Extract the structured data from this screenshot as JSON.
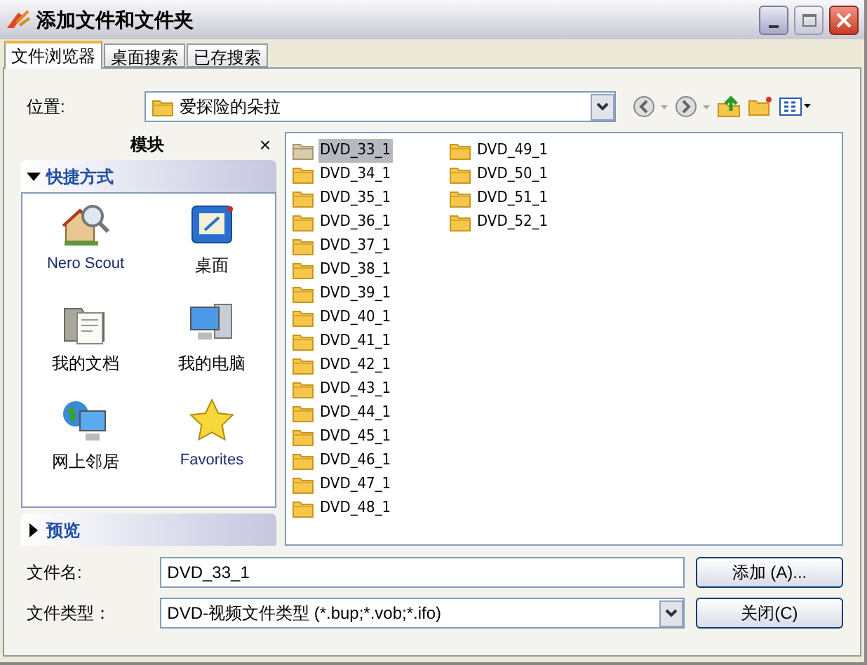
{
  "window": {
    "title": "添加文件和文件夹"
  },
  "tabs": [
    {
      "label": "文件浏览器",
      "selected": true
    },
    {
      "label": "桌面搜索",
      "selected": false
    },
    {
      "label": "已存搜索",
      "selected": false
    }
  ],
  "location": {
    "label": "位置:",
    "value": "爱探险的朵拉"
  },
  "modules": {
    "title": "模块",
    "close": "×",
    "sections": [
      {
        "title": "快捷方式",
        "expanded": true,
        "items": [
          {
            "label": "Nero Scout",
            "kind": "scout"
          },
          {
            "label": "桌面",
            "kind": "desktop"
          },
          {
            "label": "我的文档",
            "kind": "documents"
          },
          {
            "label": "我的电脑",
            "kind": "computer"
          },
          {
            "label": "网上邻居",
            "kind": "network"
          },
          {
            "label": "Favorites",
            "kind": "favorites"
          }
        ]
      },
      {
        "title": "预览",
        "expanded": false
      }
    ]
  },
  "files": [
    {
      "name": "DVD_33_1",
      "selected": true
    },
    {
      "name": "DVD_34_1",
      "selected": false
    },
    {
      "name": "DVD_35_1",
      "selected": false
    },
    {
      "name": "DVD_36_1",
      "selected": false
    },
    {
      "name": "DVD_37_1",
      "selected": false
    },
    {
      "name": "DVD_38_1",
      "selected": false
    },
    {
      "name": "DVD_39_1",
      "selected": false
    },
    {
      "name": "DVD_40_1",
      "selected": false
    },
    {
      "name": "DVD_41_1",
      "selected": false
    },
    {
      "name": "DVD_42_1",
      "selected": false
    },
    {
      "name": "DVD_43_1",
      "selected": false
    },
    {
      "name": "DVD_44_1",
      "selected": false
    },
    {
      "name": "DVD_45_1",
      "selected": false
    },
    {
      "name": "DVD_46_1",
      "selected": false
    },
    {
      "name": "DVD_47_1",
      "selected": false
    },
    {
      "name": "DVD_48_1",
      "selected": false
    },
    {
      "name": "DVD_49_1",
      "selected": false
    },
    {
      "name": "DVD_50_1",
      "selected": false
    },
    {
      "name": "DVD_51_1",
      "selected": false
    },
    {
      "name": "DVD_52_1",
      "selected": false
    }
  ],
  "file_name": {
    "label": "文件名:",
    "value": "DVD_33_1"
  },
  "file_type": {
    "label": "文件类型：",
    "value": "DVD-视频文件类型 (*.bup;*.vob;*.ifo)"
  },
  "buttons": {
    "add": "添加 (A)...",
    "close": "关闭(C)"
  }
}
